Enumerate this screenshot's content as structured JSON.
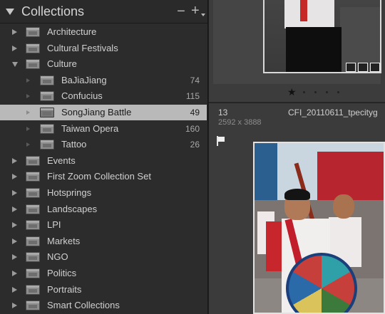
{
  "panel": {
    "title": "Collections",
    "minus_label": "−",
    "plus_label": "+"
  },
  "tree": [
    {
      "label": "Architecture",
      "level": 0,
      "state": "closed",
      "count": ""
    },
    {
      "label": "Cultural Festivals",
      "level": 0,
      "state": "closed",
      "count": ""
    },
    {
      "label": "Culture",
      "level": 0,
      "state": "open",
      "count": ""
    },
    {
      "label": "BaJiaJiang",
      "level": 1,
      "state": "leaf",
      "count": "74"
    },
    {
      "label": "Confucius",
      "level": 1,
      "state": "leaf",
      "count": "115"
    },
    {
      "label": "SongJiang Battle",
      "level": 1,
      "state": "leaf",
      "count": "49",
      "selected": true
    },
    {
      "label": "Taiwan Opera",
      "level": 1,
      "state": "leaf",
      "count": "160"
    },
    {
      "label": "Tattoo",
      "level": 1,
      "state": "leaf",
      "count": "26"
    },
    {
      "label": "Events",
      "level": 0,
      "state": "closed",
      "count": ""
    },
    {
      "label": "First Zoom Collection Set",
      "level": 0,
      "state": "closed",
      "count": ""
    },
    {
      "label": "Hotsprings",
      "level": 0,
      "state": "closed",
      "count": ""
    },
    {
      "label": "Landscapes",
      "level": 0,
      "state": "closed",
      "count": ""
    },
    {
      "label": "LPI",
      "level": 0,
      "state": "closed",
      "count": ""
    },
    {
      "label": "Markets",
      "level": 0,
      "state": "closed",
      "count": ""
    },
    {
      "label": "NGO",
      "level": 0,
      "state": "closed",
      "count": ""
    },
    {
      "label": "Politics",
      "level": 0,
      "state": "closed",
      "count": ""
    },
    {
      "label": "Portraits",
      "level": 0,
      "state": "closed",
      "count": ""
    },
    {
      "label": "Smart Collections",
      "level": 0,
      "state": "closed",
      "count": ""
    }
  ],
  "grid": {
    "rating_star": "★",
    "photo_index": "13",
    "photo_dimensions": "2592 x 3888",
    "photo_filename": "CFI_20110611_tpecityg"
  },
  "colors": {
    "panel_bg": "#2c2c2c",
    "selected_row": "#b9b9b9",
    "text": "#d0d0d0"
  }
}
